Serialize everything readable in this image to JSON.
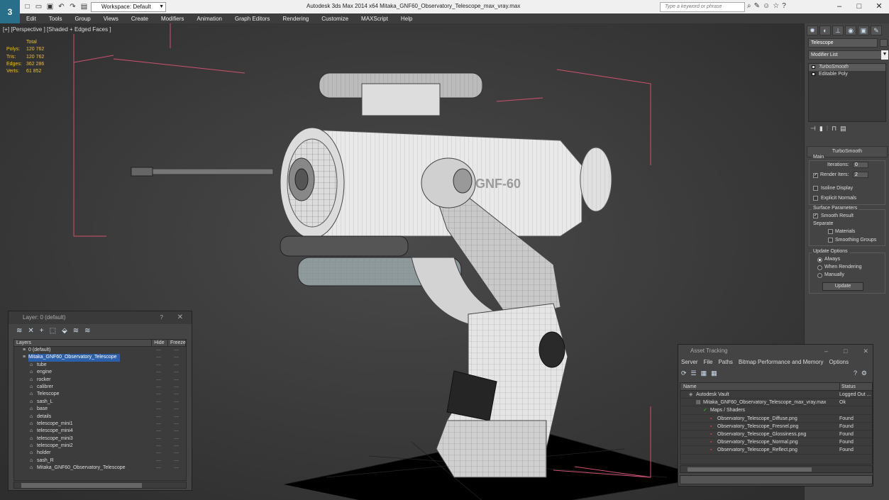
{
  "app": {
    "title": "Autodesk 3ds Max  2014 x64     Mitaka_GNF60_Observatory_Telescope_max_vray.max",
    "workspace": "Workspace: Default",
    "search_placeholder": "Type a keyword or phrase",
    "logo_icon": "3ds-max-logo-icon"
  },
  "menu": [
    "Edit",
    "Tools",
    "Group",
    "Views",
    "Create",
    "Modifiers",
    "Animation",
    "Graph Editors",
    "Rendering",
    "Customize",
    "MAXScript",
    "Help"
  ],
  "viewport": {
    "label": "[+] [Perspective ] [Shaded + Edged Faces ]",
    "stats": {
      "header": "Total",
      "rows": [
        {
          "k": "Polys:",
          "v": "120 762"
        },
        {
          "k": "Tris:",
          "v": "120 762"
        },
        {
          "k": "Edges:",
          "v": "362 286"
        },
        {
          "k": "Verts:",
          "v": "61 852"
        }
      ]
    },
    "model_text": "GNF-60"
  },
  "command_panel": {
    "object_name": "Telescope",
    "modifier_list": "Modifier List",
    "stack": [
      {
        "label": "TurboSmooth",
        "selected": true
      },
      {
        "label": "Editable Poly",
        "selected": false
      }
    ],
    "rollout_title": "TurboSmooth",
    "main_label": "Main",
    "iterations_label": "Iterations:",
    "iterations_value": "0",
    "render_iters_label": "Render Iters:",
    "render_iters_value": "2",
    "render_iters_checked": true,
    "isoline_label": "Isoline Display",
    "explicit_label": "Explicit Normals",
    "surface_params_label": "Surface Parameters",
    "smooth_result_label": "Smooth Result",
    "separate_label": "Separate",
    "materials_label": "Materials",
    "smoothing_groups_label": "Smoothing Groups",
    "update_options_label": "Update Options",
    "always_label": "Always",
    "when_rendering_label": "When Rendering",
    "manually_label": "Manually",
    "update_button": "Update"
  },
  "layer_window": {
    "title": "Layer: 0 (default)",
    "help": "?",
    "columns": [
      "Layers",
      "Hide",
      "Freeze"
    ],
    "rows": [
      {
        "name": "0 (default)",
        "indent": 1
      },
      {
        "name": "Mitaka_GNF60_Observatory_Telescope",
        "indent": 1,
        "selected": true
      },
      {
        "name": "tube",
        "indent": 2
      },
      {
        "name": "engine",
        "indent": 2
      },
      {
        "name": "rocker",
        "indent": 2
      },
      {
        "name": "calibrer",
        "indent": 2
      },
      {
        "name": "Telescope",
        "indent": 2
      },
      {
        "name": "sash_L",
        "indent": 2
      },
      {
        "name": "base",
        "indent": 2
      },
      {
        "name": "details",
        "indent": 2
      },
      {
        "name": "telescope_mini1",
        "indent": 2
      },
      {
        "name": "telescope_mini4",
        "indent": 2
      },
      {
        "name": "telescope_mini3",
        "indent": 2
      },
      {
        "name": "telescope_mini2",
        "indent": 2
      },
      {
        "name": "holder",
        "indent": 2
      },
      {
        "name": "sash_R",
        "indent": 2
      },
      {
        "name": "Mitaka_GNF60_Observatory_Telescope",
        "indent": 2
      }
    ]
  },
  "asset_window": {
    "title": "Asset Tracking",
    "menu": [
      "Server",
      "File",
      "Paths",
      "Bitmap Performance and Memory",
      "Options"
    ],
    "columns": [
      "Name",
      "Status"
    ],
    "rows": [
      {
        "name": "Autodesk Vault",
        "status": "Logged Out ...",
        "indent": 1
      },
      {
        "name": "Mitaka_GNF60_Observatory_Telescope_max_vray.max",
        "status": "Ok",
        "indent": 2
      },
      {
        "name": "Maps / Shaders",
        "status": "",
        "indent": 3
      },
      {
        "name": "Observatory_Telescope_Diffuse.png",
        "status": "Found",
        "indent": 4
      },
      {
        "name": "Observatory_Telescope_Fresnel.png",
        "status": "Found",
        "indent": 4
      },
      {
        "name": "Observatory_Telescope_Glossiness.png",
        "status": "Found",
        "indent": 4
      },
      {
        "name": "Observatory_Telescope_Normal.png",
        "status": "Found",
        "indent": 4
      },
      {
        "name": "Observatory_Telescope_Reflect.png",
        "status": "Found",
        "indent": 4
      }
    ]
  }
}
